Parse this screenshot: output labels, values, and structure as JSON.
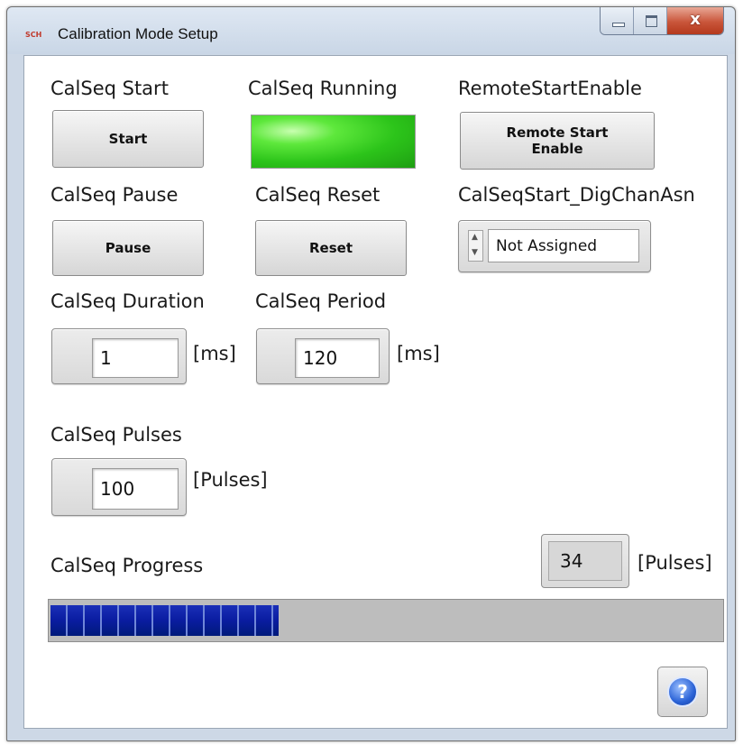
{
  "window": {
    "title": "Calibration Mode Setup",
    "app_icon_text": "SCH",
    "close_glyph": "x"
  },
  "controls": {
    "start": {
      "label": "CalSeq Start",
      "button": "Start"
    },
    "running": {
      "label": "CalSeq Running",
      "state": "on",
      "color": "#2cc41a"
    },
    "remote": {
      "label": "RemoteStartEnable",
      "button_line1": "Remote Start",
      "button_line2": "Enable"
    },
    "pause": {
      "label": "CalSeq Pause",
      "button": "Pause"
    },
    "reset": {
      "label": "CalSeq Reset",
      "button": "Reset"
    },
    "digchan": {
      "label": "CalSeqStart_DigChanAsn",
      "value": "Not Assigned"
    },
    "duration": {
      "label": "CalSeq Duration",
      "value": "1",
      "unit": "[ms]"
    },
    "period": {
      "label": "CalSeq Period",
      "value": "120",
      "unit": "[ms]"
    },
    "pulses": {
      "label": "CalSeq Pulses",
      "value": "100",
      "unit": "[Pulses]"
    }
  },
  "progress": {
    "label": "CalSeq Progress",
    "count": "34",
    "unit": "[Pulses]",
    "fraction": 0.34,
    "fill_color": "#0a1ca0"
  },
  "help": {
    "icon": "help-icon",
    "glyph": "?"
  }
}
